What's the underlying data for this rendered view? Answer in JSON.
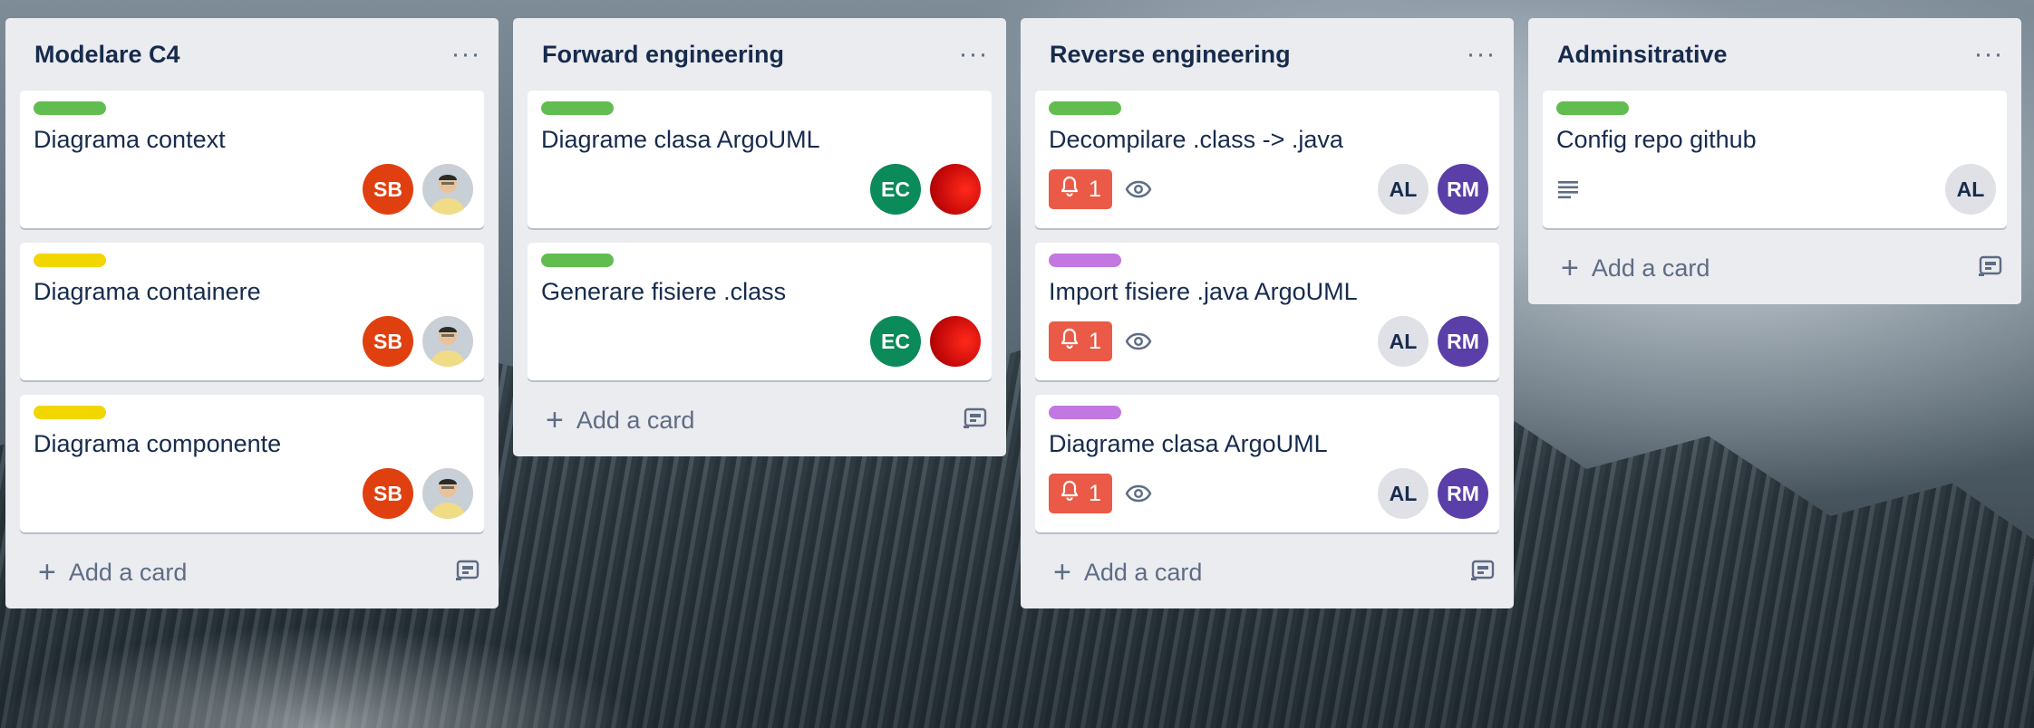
{
  "lists": [
    {
      "title": "Modelare C4",
      "add_card_label": "Add a card",
      "cards": [
        {
          "label_color": "#61bd4f",
          "title": "Diagrama context",
          "members": [
            {
              "initials": "SB",
              "color": "#e0400f"
            },
            {
              "photo": true
            }
          ]
        },
        {
          "label_color": "#f2d600",
          "title": "Diagrama containere",
          "members": [
            {
              "initials": "SB",
              "color": "#e0400f"
            },
            {
              "photo": true
            }
          ]
        },
        {
          "label_color": "#f2d600",
          "title": "Diagrama componente",
          "members": [
            {
              "initials": "SB",
              "color": "#e0400f"
            },
            {
              "photo": true
            }
          ]
        }
      ]
    },
    {
      "title": "Forward engineering",
      "add_card_label": "Add a card",
      "cards": [
        {
          "label_color": "#61bd4f",
          "title": "Diagrame clasa ArgoUML",
          "members": [
            {
              "initials": "EC",
              "color": "#0b8a5a"
            },
            {
              "red": true
            }
          ]
        },
        {
          "label_color": "#61bd4f",
          "title": "Generare fisiere .class",
          "members": [
            {
              "initials": "EC",
              "color": "#0b8a5a"
            },
            {
              "red": true
            }
          ]
        }
      ]
    },
    {
      "title": "Reverse engineering",
      "add_card_label": "Add a card",
      "cards": [
        {
          "label_color": "#61bd4f",
          "title": "Decompilare .class -> .java",
          "notification_count": "1",
          "watching": true,
          "members": [
            {
              "initials": "AL",
              "light": true
            },
            {
              "initials": "RM",
              "color": "#5b3fa8"
            }
          ]
        },
        {
          "label_color": "#c377e0",
          "title": "Import fisiere .java ArgoUML",
          "notification_count": "1",
          "watching": true,
          "members": [
            {
              "initials": "AL",
              "light": true
            },
            {
              "initials": "RM",
              "color": "#5b3fa8"
            }
          ]
        },
        {
          "label_color": "#c377e0",
          "title": "Diagrame clasa ArgoUML",
          "notification_count": "1",
          "watching": true,
          "members": [
            {
              "initials": "AL",
              "light": true
            },
            {
              "initials": "RM",
              "color": "#5b3fa8"
            }
          ]
        }
      ]
    },
    {
      "title": "Adminsitrative",
      "add_card_label": "Add a card",
      "cards": [
        {
          "label_color": "#61bd4f",
          "title": "Config repo github",
          "has_description": true,
          "members": [
            {
              "initials": "AL",
              "light": true
            }
          ]
        }
      ]
    }
  ]
}
